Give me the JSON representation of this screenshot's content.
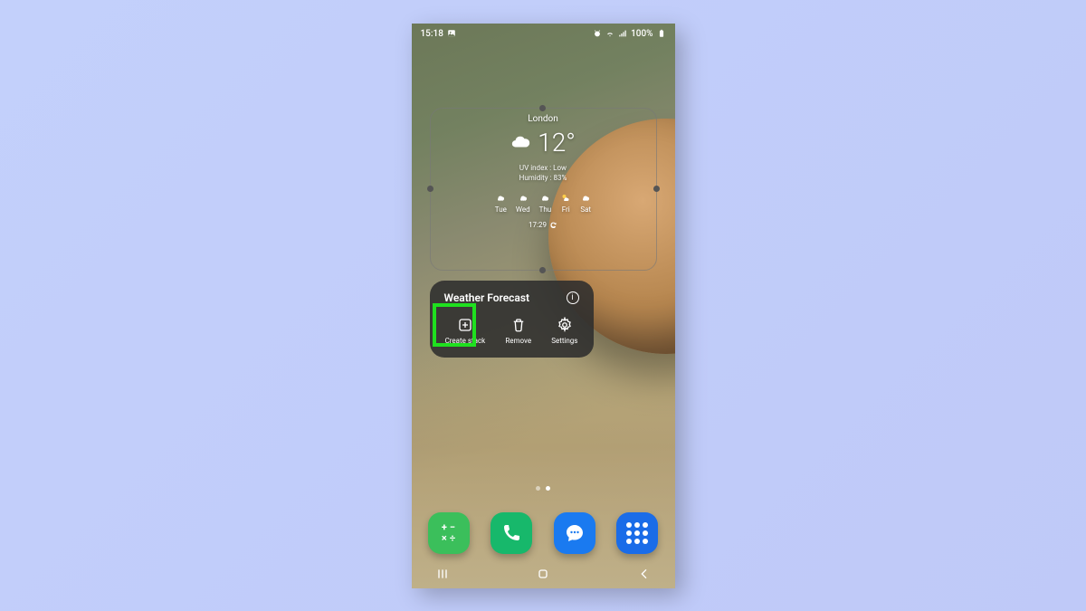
{
  "status": {
    "time": "15:18",
    "battery_pct": "100%"
  },
  "weather": {
    "city": "London",
    "temperature": "12°",
    "uv_label": "UV index : Low",
    "humidity_label": "Humidity : 83%",
    "days": [
      "Tue",
      "Wed",
      "Thu",
      "Fri",
      "Sat"
    ],
    "update_time": "17:29"
  },
  "context_menu": {
    "title": "Weather Forecast",
    "actions": {
      "create_stack": "Create stack",
      "remove": "Remove",
      "settings": "Settings"
    }
  },
  "highlight": {
    "color": "#1fe01f"
  }
}
